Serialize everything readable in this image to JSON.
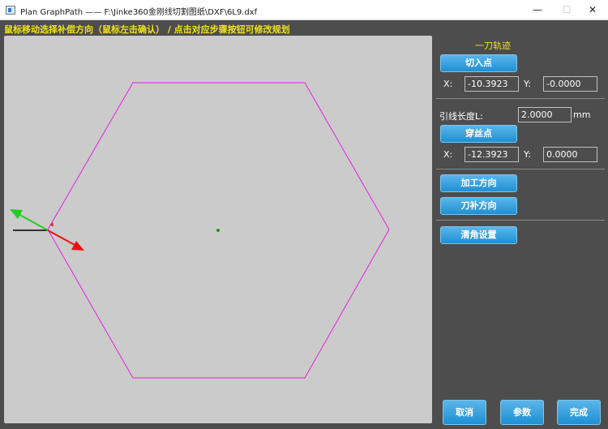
{
  "window": {
    "title": "Plan GraphPath —— F:\\Jinke360金刚线切割图纸\\DXF\\6L9.dxf",
    "minimize": "—",
    "maximize": "☐",
    "close": "✕"
  },
  "hint": "鼠标移动选择补偿方向（鼠标左击确认） / 点击对应步骤按钮可修改规划",
  "panel": {
    "section_title": "一刀轨迹",
    "cut_in_button": "切入点",
    "cut_in_x_label": "X:",
    "cut_in_x": "-10.3923",
    "cut_in_y_label": "Y:",
    "cut_in_y": "-0.0000",
    "lead_length_label": "引线长度L:",
    "lead_length": "2.0000",
    "lead_length_unit": "mm",
    "thread_button": "穿丝点",
    "thread_x_label": "X:",
    "thread_x": "-12.3923",
    "thread_y_label": "Y:",
    "thread_y": "0.0000",
    "direction_button": "加工方向",
    "compensation_button": "刀补方向",
    "corner_button": "清角设置"
  },
  "footer": {
    "cancel": "取消",
    "params": "参数",
    "finish": "完成"
  },
  "colors": {
    "hexagon": "#e020e0",
    "arrow_green": "#22cc22",
    "arrow_red": "#ee1111",
    "hint_yellow": "#f2e21c",
    "button_blue": "#2a9ad9"
  }
}
